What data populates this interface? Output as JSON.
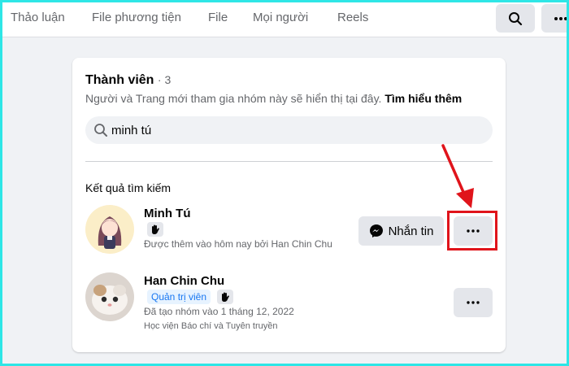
{
  "nav": {
    "tabs": [
      {
        "label": "Thảo luận"
      },
      {
        "label": "File phương tiện"
      },
      {
        "label": "File"
      },
      {
        "label": "Mọi người"
      },
      {
        "label": "Reels"
      }
    ],
    "search_icon": "search-icon",
    "more_icon": "more-icon"
  },
  "members": {
    "title": "Thành viên",
    "count": "· 3",
    "description": "Người và Trang mới tham gia nhóm này sẽ hiển thị tại đây.",
    "learn_more": "Tìm hiểu thêm",
    "search_value": "minh tú",
    "results_heading": "Kết quả tìm kiếm",
    "results": [
      {
        "name": "Minh Tú",
        "line1": "Được thêm vào hôm nay bởi Han Chin Chu",
        "message_label": "Nhắn tin"
      },
      {
        "name": "Han Chin Chu",
        "badge": "Quản trị viên",
        "line1": "Đã tạo nhóm vào 1 tháng 12, 2022",
        "line2": "Học viện Báo chí và Tuyên truyền"
      }
    ]
  },
  "colors": {
    "accent": "#1877f2",
    "annotation": "#e0141b",
    "frame": "#2ee6e6"
  }
}
